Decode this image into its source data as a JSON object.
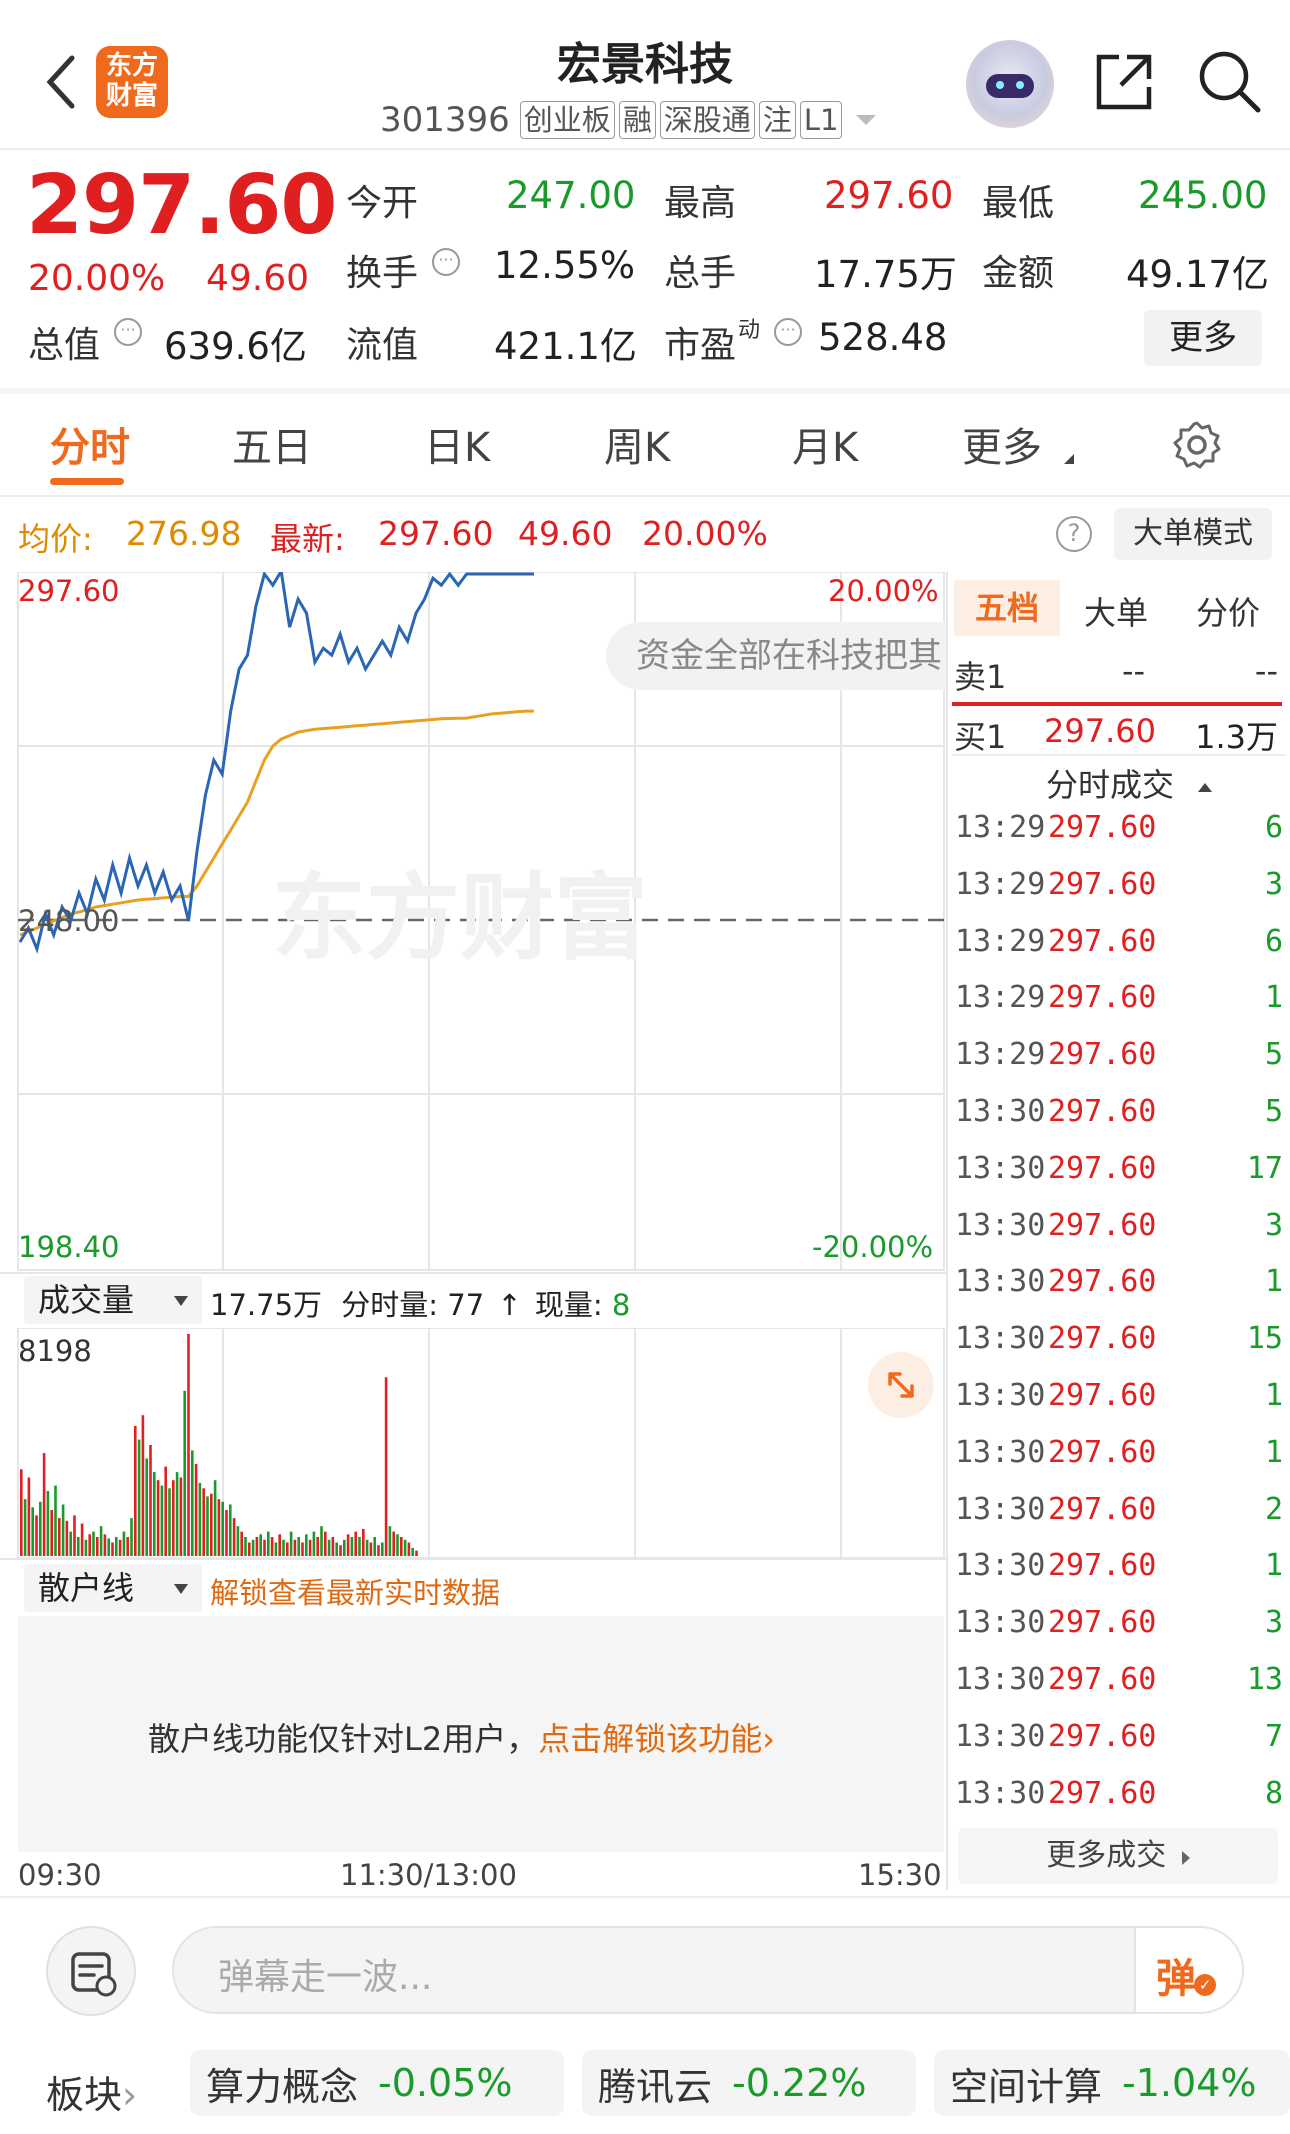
{
  "header": {
    "logo_text": "东方财富",
    "stock_name": "宏景科技",
    "stock_code": "301396",
    "tags": [
      "创业板",
      "融",
      "深股通",
      "注",
      "L1"
    ]
  },
  "quote": {
    "price": "297.60",
    "change_pct": "20.00%",
    "change": "49.60",
    "open_label": "今开",
    "open": "247.00",
    "high_label": "最高",
    "high": "297.60",
    "low_label": "最低",
    "low": "245.00",
    "turnover_label": "换手",
    "turnover": "12.55%",
    "volume_label": "总手",
    "volume": "17.75万",
    "amount_label": "金额",
    "amount": "49.17亿",
    "mcap_label": "总值",
    "mcap": "639.6亿",
    "float_label": "流值",
    "float": "421.1亿",
    "pe_label": "市盈",
    "pe_sup": "动",
    "pe": "528.48",
    "more": "更多"
  },
  "tabs": [
    "分时",
    "五日",
    "日K",
    "周K",
    "月K",
    "更多"
  ],
  "chart_header": {
    "avg_label": "均价:",
    "avg": "276.98",
    "latest_label": "最新:",
    "latest": "297.60",
    "latest_chg": "49.60",
    "latest_pct": "20.00%",
    "big_order_mode": "大单模式"
  },
  "chart_data": {
    "type": "line",
    "y_top": "297.60",
    "y_mid": "248.00",
    "y_bottom": "198.40",
    "pct_top": "20.00%",
    "pct_bottom": "-20.00%",
    "ylim": [
      198.4,
      297.6
    ],
    "x_labels": [
      "09:30",
      "11:30/13:00",
      "15:30"
    ],
    "series": [
      {
        "color": "#2a66b5",
        "values": [
          245,
          247,
          244,
          249,
          246,
          250,
          248,
          252,
          249,
          254,
          251,
          256,
          252,
          257,
          253,
          256,
          252,
          255,
          251,
          253,
          248,
          258,
          266,
          271,
          269,
          278,
          284,
          286,
          293,
          297.6,
          296,
          298,
          290,
          294,
          292,
          285,
          287,
          286,
          289,
          285,
          287,
          284,
          286,
          288,
          286,
          290,
          288,
          292,
          294,
          297,
          296,
          297.6,
          296,
          297.6,
          297.6,
          297.6,
          297.6,
          297.6,
          297.6,
          297.6,
          297.6,
          297.6
        ]
      },
      {
        "color": "#e8a020",
        "values": [
          246,
          246.5,
          247,
          247.5,
          248,
          248.5,
          249,
          249.3,
          249.6,
          250,
          250.2,
          250.4,
          250.6,
          250.8,
          251,
          251.1,
          251.2,
          251.3,
          251.4,
          251.5,
          251.5,
          253,
          255,
          257,
          259,
          261,
          263,
          265,
          268,
          271,
          273,
          274,
          274.5,
          275,
          275.2,
          275.4,
          275.5,
          275.6,
          275.7,
          275.8,
          275.9,
          276,
          276.1,
          276.2,
          276.3,
          276.4,
          276.5,
          276.6,
          276.7,
          276.8,
          276.9,
          276.95,
          276.98,
          277,
          277.2,
          277.4,
          277.6,
          277.7,
          277.8,
          277.9,
          278,
          278
        ]
      }
    ],
    "banner": "资金全部在科技把其"
  },
  "volume": {
    "label": "成交量",
    "total": "17.75万",
    "min_label": "分时量:",
    "min_val": "77",
    "cur_label": "现量:",
    "cur_val": "8",
    "max": "8198",
    "bars": [
      3200,
      2100,
      2900,
      1800,
      1500,
      2000,
      3800,
      2400,
      1700,
      2600,
      1400,
      1900,
      1300,
      900,
      1500,
      700,
      1200,
      600,
      800,
      900,
      700,
      1100,
      800,
      650,
      500,
      700,
      600,
      900,
      700,
      1400,
      4800,
      4300,
      5200,
      3600,
      4100,
      3100,
      2800,
      2600,
      3300,
      2500,
      2800,
      3100,
      2900,
      6100,
      8198,
      3900,
      3400,
      2700,
      2500,
      2200,
      2300,
      2800,
      2100,
      2000,
      1700,
      1900,
      1400,
      1100,
      900,
      700,
      500,
      600,
      700,
      800,
      600,
      900,
      700,
      500,
      800,
      600,
      500,
      900,
      600,
      700,
      500,
      800,
      600,
      900,
      700,
      1100,
      900,
      600,
      700,
      500,
      400,
      600,
      800,
      700,
      900,
      700,
      1000,
      600,
      500,
      700,
      400,
      500,
      6600,
      1100,
      900,
      800,
      700,
      600,
      500,
      300,
      200
    ],
    "bar_colors": [
      "r",
      "g"
    ]
  },
  "retail": {
    "label": "散户线",
    "unlock": "解锁查看最新实时数据",
    "msg": "散户线功能仅针对L2用户，",
    "msg_link": "点击解锁该功能"
  },
  "orderbook": {
    "tabs": [
      "五档",
      "大单",
      "分价"
    ],
    "sell_label": "卖1",
    "sell_price": "--",
    "sell_vol": "--",
    "buy_label": "买1",
    "buy_price": "297.60",
    "buy_vol": "1.3万",
    "ticks_title": "分时成交",
    "ticks": [
      {
        "t": "13:29",
        "p": "297.60",
        "v": "6"
      },
      {
        "t": "13:29",
        "p": "297.60",
        "v": "3"
      },
      {
        "t": "13:29",
        "p": "297.60",
        "v": "6"
      },
      {
        "t": "13:29",
        "p": "297.60",
        "v": "1"
      },
      {
        "t": "13:29",
        "p": "297.60",
        "v": "5"
      },
      {
        "t": "13:30",
        "p": "297.60",
        "v": "5"
      },
      {
        "t": "13:30",
        "p": "297.60",
        "v": "17"
      },
      {
        "t": "13:30",
        "p": "297.60",
        "v": "3"
      },
      {
        "t": "13:30",
        "p": "297.60",
        "v": "1"
      },
      {
        "t": "13:30",
        "p": "297.60",
        "v": "15"
      },
      {
        "t": "13:30",
        "p": "297.60",
        "v": "1"
      },
      {
        "t": "13:30",
        "p": "297.60",
        "v": "1"
      },
      {
        "t": "13:30",
        "p": "297.60",
        "v": "2"
      },
      {
        "t": "13:30",
        "p": "297.60",
        "v": "1"
      },
      {
        "t": "13:30",
        "p": "297.60",
        "v": "3"
      },
      {
        "t": "13:30",
        "p": "297.60",
        "v": "13"
      },
      {
        "t": "13:30",
        "p": "297.60",
        "v": "7"
      },
      {
        "t": "13:30",
        "p": "297.60",
        "v": "8"
      }
    ],
    "more_ticks": "更多成交"
  },
  "danmaku": {
    "placeholder": "弹幕走一波...",
    "send": "弹"
  },
  "sectors": {
    "label": "板块",
    "items": [
      {
        "name": "算力概念",
        "pct": "-0.05%"
      },
      {
        "name": "腾讯云",
        "pct": "-0.22%"
      },
      {
        "name": "空间计算",
        "pct": "-1.04%"
      }
    ]
  }
}
